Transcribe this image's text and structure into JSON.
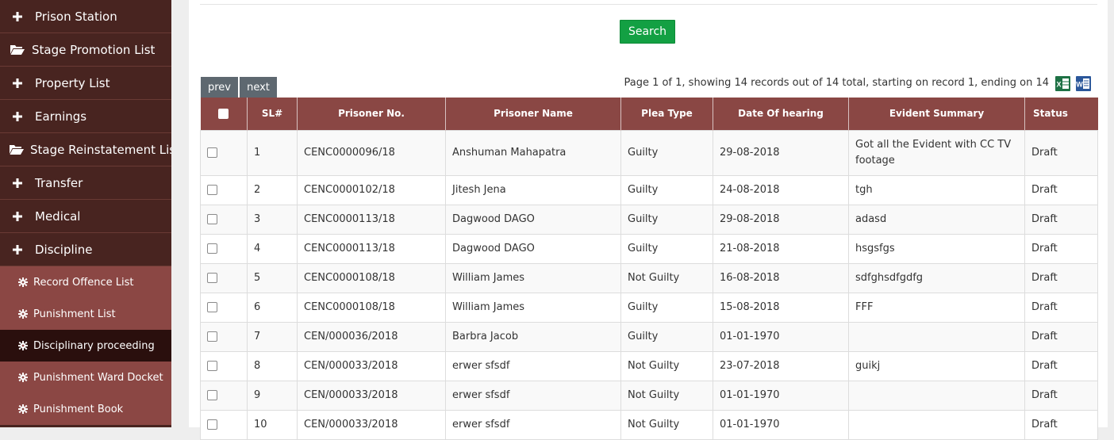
{
  "sidebar": {
    "items": [
      {
        "label": "Prison Station",
        "icon": "plus-icon"
      },
      {
        "label": "Stage Promotion List",
        "icon": "folder-open-icon"
      },
      {
        "label": "Property List",
        "icon": "plus-icon"
      },
      {
        "label": "Earnings",
        "icon": "plus-icon"
      },
      {
        "label": "Stage Reinstatement List",
        "icon": "folder-open-icon"
      },
      {
        "label": "Transfer",
        "icon": "plus-icon"
      },
      {
        "label": "Medical",
        "icon": "plus-icon"
      },
      {
        "label": "Discipline",
        "icon": "plus-icon"
      }
    ],
    "sub_items": [
      {
        "label": "Record Offence List",
        "icon": "gear-icon"
      },
      {
        "label": "Punishment List",
        "icon": "gear-icon"
      },
      {
        "label": "Disciplinary proceeding",
        "icon": "gear-icon",
        "active": true
      },
      {
        "label": "Punishment Ward Docket",
        "icon": "gear-icon"
      },
      {
        "label": "Punishment Book",
        "icon": "gear-icon"
      }
    ]
  },
  "search": {
    "button_label": "Search"
  },
  "pager": {
    "prev_label": "prev",
    "next_label": "next",
    "info": "Page 1 of 1, showing 14 records out of 14 total, starting on record 1, ending on 14"
  },
  "table": {
    "columns": [
      "SL#",
      "Prisoner No.",
      "Prisoner Name",
      "Plea Type",
      "Date Of hearing",
      "Evident Summary",
      "Status"
    ],
    "rows": [
      {
        "sl": "1",
        "prisoner_no": "CENC0000096/18",
        "name": "Anshuman Mahapatra",
        "plea": "Guilty",
        "date": "29-08-2018",
        "summary": "Got all the Evident with CC TV footage",
        "status": "Draft"
      },
      {
        "sl": "2",
        "prisoner_no": "CENC0000102/18",
        "name": "Jitesh Jena",
        "plea": "Guilty",
        "date": "24-08-2018",
        "summary": "tgh",
        "status": "Draft"
      },
      {
        "sl": "3",
        "prisoner_no": "CENC0000113/18",
        "name": "Dagwood DAGO",
        "plea": "Guilty",
        "date": "29-08-2018",
        "summary": "adasd",
        "status": "Draft"
      },
      {
        "sl": "4",
        "prisoner_no": "CENC0000113/18",
        "name": "Dagwood DAGO",
        "plea": "Guilty",
        "date": "21-08-2018",
        "summary": "hsgsfgs",
        "status": "Draft"
      },
      {
        "sl": "5",
        "prisoner_no": "CENC0000108/18",
        "name": "William James",
        "plea": "Not Guilty",
        "date": "16-08-2018",
        "summary": "sdfghsdfgdfg",
        "status": "Draft"
      },
      {
        "sl": "6",
        "prisoner_no": "CENC0000108/18",
        "name": "William James",
        "plea": "Guilty",
        "date": "15-08-2018",
        "summary": "FFF",
        "status": "Draft"
      },
      {
        "sl": "7",
        "prisoner_no": "CEN/000036/2018",
        "name": "Barbra Jacob",
        "plea": "Guilty",
        "date": "01-01-1970",
        "summary": "",
        "status": "Draft"
      },
      {
        "sl": "8",
        "prisoner_no": "CEN/000033/2018",
        "name": "erwer sfsdf",
        "plea": "Not Guilty",
        "date": "23-07-2018",
        "summary": "guikj",
        "status": "Draft"
      },
      {
        "sl": "9",
        "prisoner_no": "CEN/000033/2018",
        "name": "erwer sfsdf",
        "plea": "Not Guilty",
        "date": "01-01-1970",
        "summary": "",
        "status": "Draft"
      },
      {
        "sl": "10",
        "prisoner_no": "CEN/000033/2018",
        "name": "erwer sfsdf",
        "plea": "Not Guilty",
        "date": "01-01-1970",
        "summary": "",
        "status": "Draft"
      }
    ]
  },
  "colors": {
    "sidebar_bg": "#482420",
    "submenu_bg": "#8b4744",
    "submenu_active_bg": "#2a0f0d",
    "table_header_bg": "#8a4744",
    "search_button": "#13a043",
    "pager_button": "#5e6870"
  }
}
